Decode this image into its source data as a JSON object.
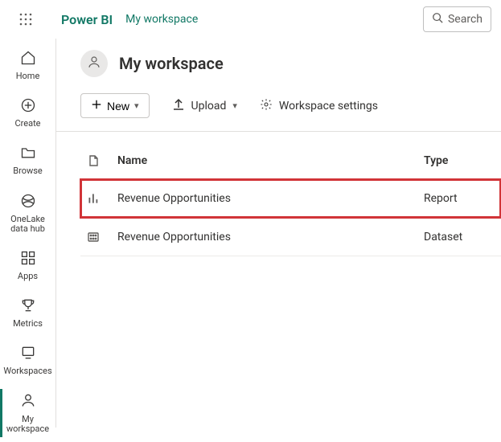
{
  "header": {
    "brand": "Power BI",
    "breadcrumb": "My workspace",
    "search_label": "Search"
  },
  "rail": {
    "home": "Home",
    "create": "Create",
    "browse": "Browse",
    "datahub": "OneLake data hub",
    "apps": "Apps",
    "metrics": "Metrics",
    "workspaces": "Workspaces",
    "my_workspace": "My workspace"
  },
  "workspace": {
    "title": "My workspace"
  },
  "toolbar": {
    "new_label": "New",
    "upload_label": "Upload",
    "settings_label": "Workspace settings"
  },
  "table": {
    "col_name": "Name",
    "col_type": "Type",
    "rows": [
      {
        "name": "Revenue Opportunities",
        "type": "Report"
      },
      {
        "name": "Revenue Opportunities",
        "type": "Dataset"
      }
    ]
  }
}
